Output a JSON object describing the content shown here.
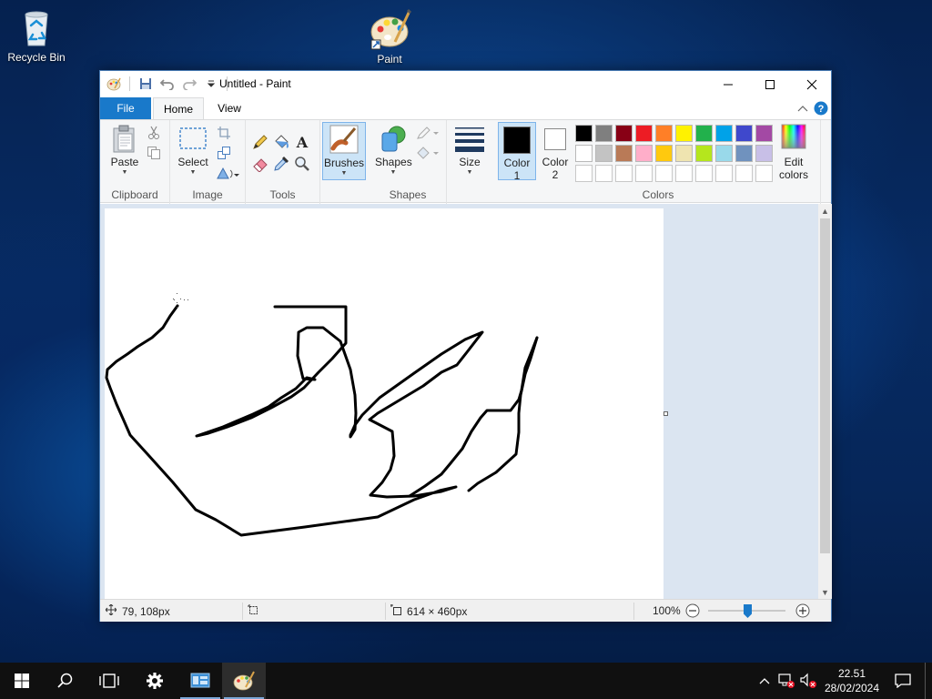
{
  "desktop": {
    "icons": [
      {
        "label": "Recycle Bin",
        "icon": "recycle-bin-icon"
      },
      {
        "label": "Paint",
        "icon": "paint-palette-icon"
      }
    ]
  },
  "window": {
    "title": "Untitled - Paint",
    "tabs": {
      "file": "File",
      "home": "Home",
      "view": "View"
    }
  },
  "ribbon": {
    "clipboard": {
      "paste": "Paste",
      "group": "Clipboard"
    },
    "image": {
      "select": "Select",
      "group": "Image"
    },
    "tools": {
      "group": "Tools"
    },
    "brushes": {
      "label": "Brushes"
    },
    "shapes": {
      "shapes": "Shapes",
      "group": "Shapes"
    },
    "size": {
      "label": "Size"
    },
    "colors": {
      "color1_line1": "Color",
      "color1_line2": "1",
      "color2_line1": "Color",
      "color2_line2": "2",
      "edit_line1": "Edit",
      "edit_line2": "colors",
      "group": "Colors",
      "color1_value": "#000000",
      "color2_value": "#ffffff",
      "palette_row1": [
        "#000000",
        "#7f7f7f",
        "#880015",
        "#ed1c24",
        "#ff7f27",
        "#fff200",
        "#22b14c",
        "#00a2e8",
        "#3f48cc",
        "#a349a4"
      ],
      "palette_row2": [
        "#ffffff",
        "#c3c3c3",
        "#b97a57",
        "#ffaec9",
        "#ffc90e",
        "#efe4b0",
        "#b5e61d",
        "#99d9ea",
        "#7092be",
        "#c8bfe7"
      ]
    }
  },
  "status": {
    "cursor_pos": "79, 108px",
    "canvas_size": "614 × 460px",
    "zoom": "100%",
    "zoom_level_percent": 100
  },
  "taskbar": {
    "time": "22.51",
    "date": "28/02/2024"
  }
}
